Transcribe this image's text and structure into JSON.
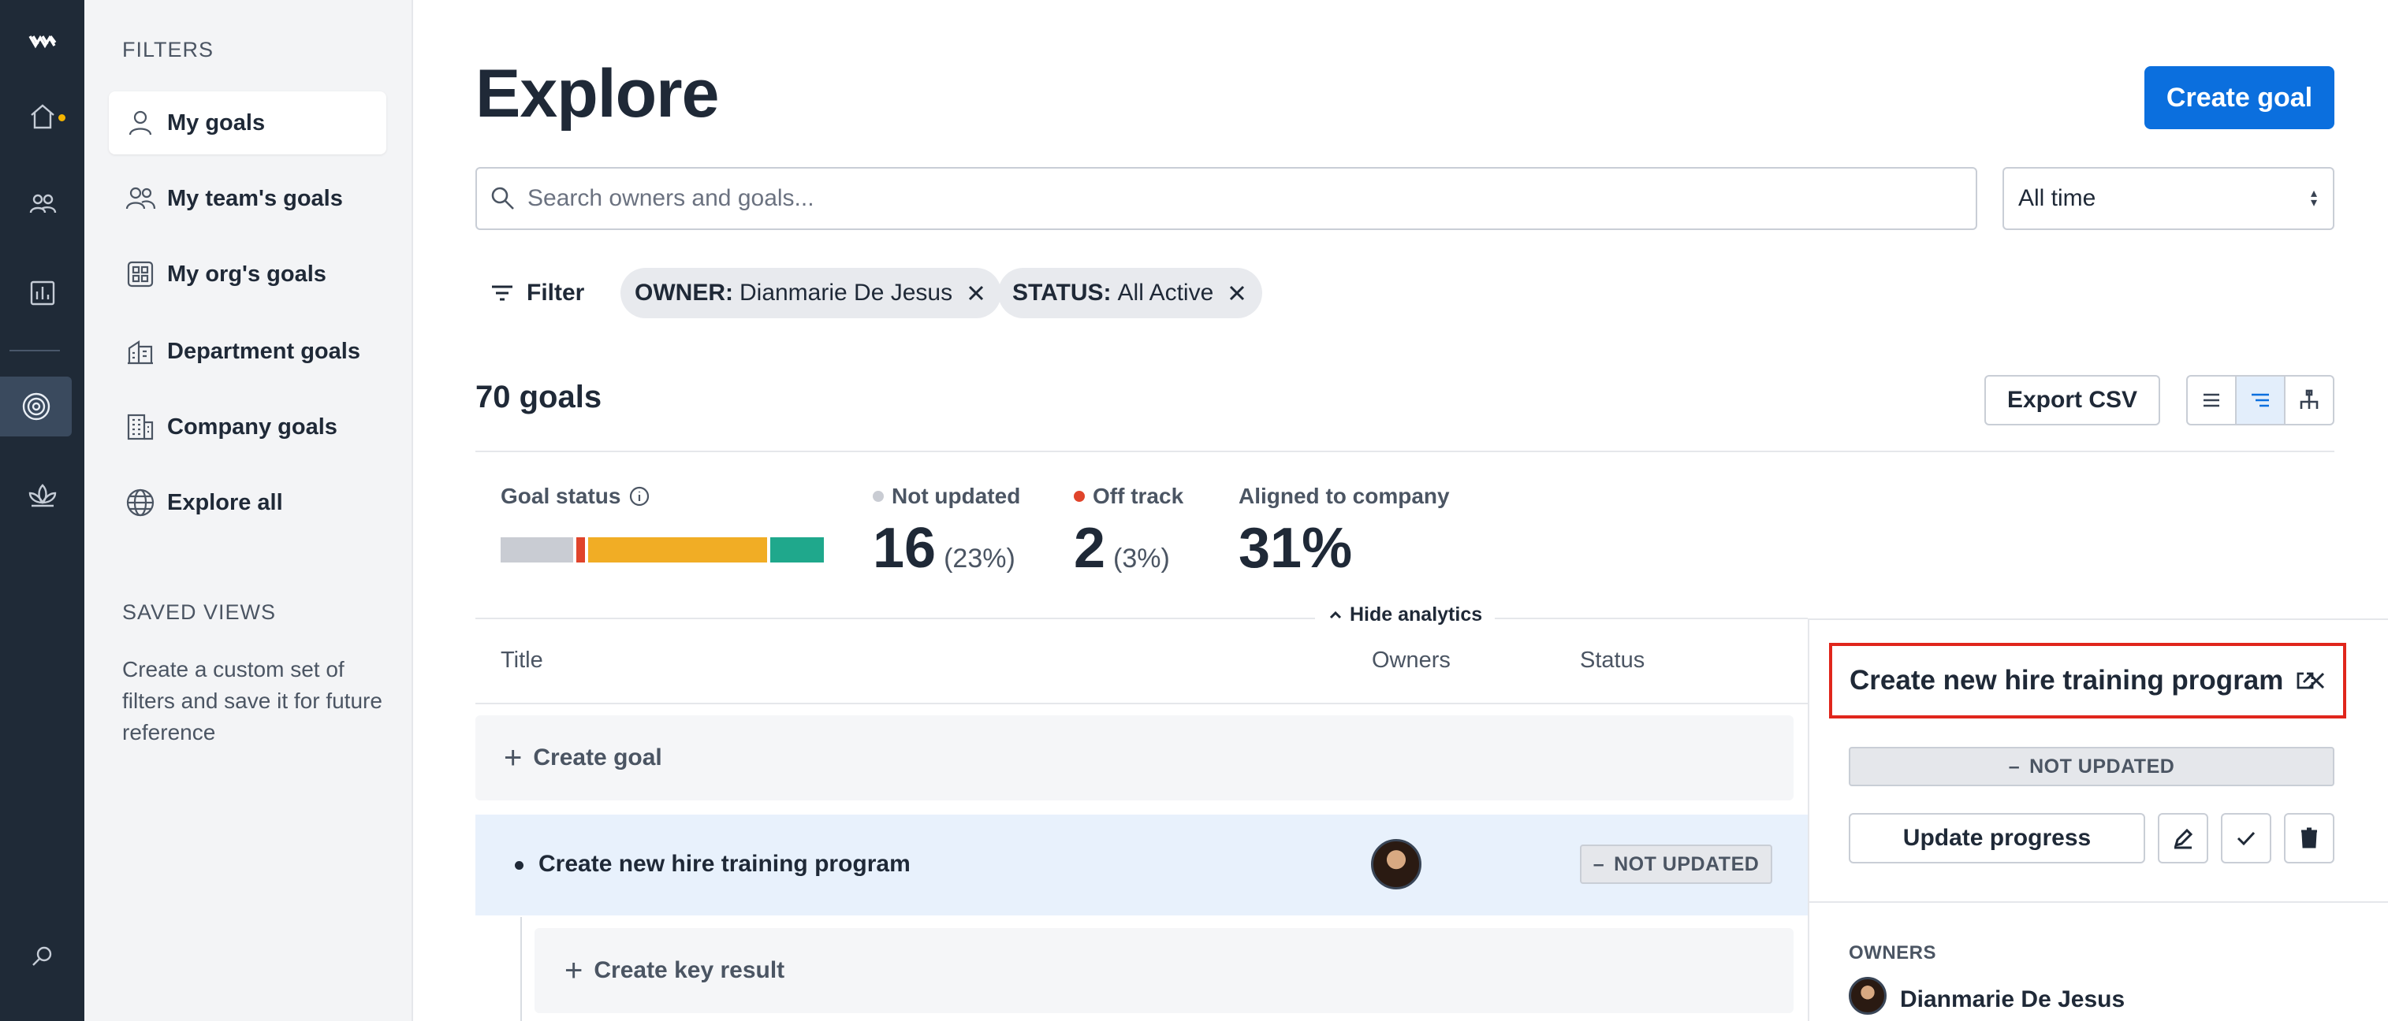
{
  "rail": {
    "items": [
      "logo-icon",
      "home-icon",
      "people-icon",
      "chart-icon",
      "target-icon",
      "lotus-icon",
      "search-icon"
    ],
    "notification_color": "#f4b400"
  },
  "filters": {
    "heading": "FILTERS",
    "items": [
      {
        "label": "My goals",
        "icon": "person-icon",
        "selected": true
      },
      {
        "label": "My team's goals",
        "icon": "team-icon",
        "selected": false
      },
      {
        "label": "My org's goals",
        "icon": "org-icon",
        "selected": false
      },
      {
        "label": "Department goals",
        "icon": "building-icon",
        "selected": false
      },
      {
        "label": "Company goals",
        "icon": "company-icon",
        "selected": false
      },
      {
        "label": "Explore all",
        "icon": "globe-icon",
        "selected": false
      }
    ],
    "saved_views_heading": "SAVED VIEWS",
    "saved_views_desc": "Create a custom set of filters and save it for future reference"
  },
  "main": {
    "title": "Explore",
    "create_goal_label": "Create goal",
    "search_placeholder": "Search owners and goals...",
    "time_select": "All time",
    "filter_label": "Filter",
    "chips": [
      {
        "key": "OWNER:",
        "value": "Dianmarie De Jesus"
      },
      {
        "key": "STATUS:",
        "value": "All Active"
      }
    ],
    "goals_count": "70 goals",
    "export_label": "Export CSV",
    "analytics": {
      "goal_status_label": "Goal status",
      "status_segments": [
        {
          "name": "not-updated",
          "percent": 23,
          "color": "#c9ccd3"
        },
        {
          "name": "off-track",
          "percent": 3,
          "color": "#e0442b"
        },
        {
          "name": "at-risk",
          "percent": 57,
          "color": "#f1ad25"
        },
        {
          "name": "on-track",
          "percent": 17,
          "color": "#1fa88c"
        }
      ],
      "not_updated_label": "Not updated",
      "not_updated_value": "16",
      "not_updated_pct": "(23%)",
      "off_track_label": "Off track",
      "off_track_value": "2",
      "off_track_pct": "(3%)",
      "aligned_label": "Aligned to company",
      "aligned_value": "31%",
      "hide_label": "Hide analytics"
    },
    "table": {
      "col_title": "Title",
      "col_owners": "Owners",
      "col_status": "Status",
      "create_goal_row": "Create goal",
      "goal_title": "Create new hire training program",
      "goal_status": "NOT UPDATED",
      "create_kr_row": "Create key result"
    }
  },
  "panel": {
    "title": "Create new hire training program",
    "status": "NOT UPDATED",
    "update_label": "Update progress",
    "owners_heading": "OWNERS",
    "owner_name": "Dianmarie De Jesus"
  }
}
